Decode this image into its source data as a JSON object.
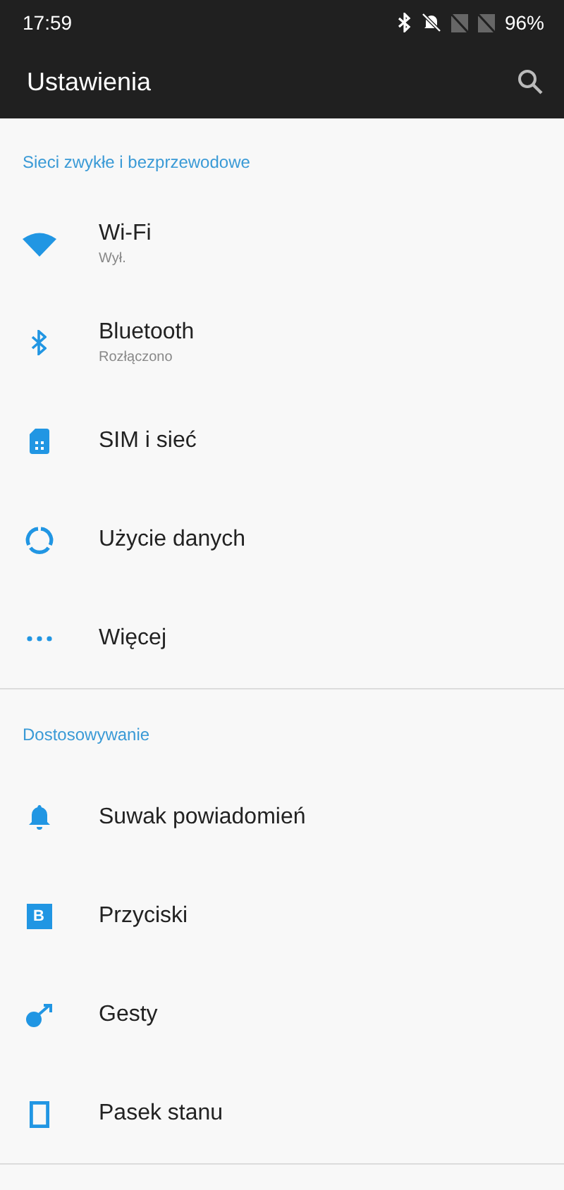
{
  "status_bar": {
    "time": "17:59",
    "battery": "96%"
  },
  "app_bar": {
    "title": "Ustawienia"
  },
  "sections": [
    {
      "title": "Sieci zwykłe i bezprzewodowe",
      "items": [
        {
          "kind": "wifi",
          "label": "Wi-Fi",
          "summary": "Wył."
        },
        {
          "kind": "bluetooth",
          "label": "Bluetooth",
          "summary": "Rozłączono"
        },
        {
          "kind": "sim",
          "label": "SIM i sieć"
        },
        {
          "kind": "data",
          "label": "Użycie danych"
        },
        {
          "kind": "more",
          "label": "Więcej"
        }
      ]
    },
    {
      "title": "Dostosowywanie",
      "items": [
        {
          "kind": "bell",
          "label": "Suwak powiadomień"
        },
        {
          "kind": "letter",
          "letter": "B",
          "label": "Przyciski"
        },
        {
          "kind": "gesture",
          "label": "Gesty"
        },
        {
          "kind": "statusbar",
          "label": "Pasek stanu"
        }
      ]
    }
  ]
}
